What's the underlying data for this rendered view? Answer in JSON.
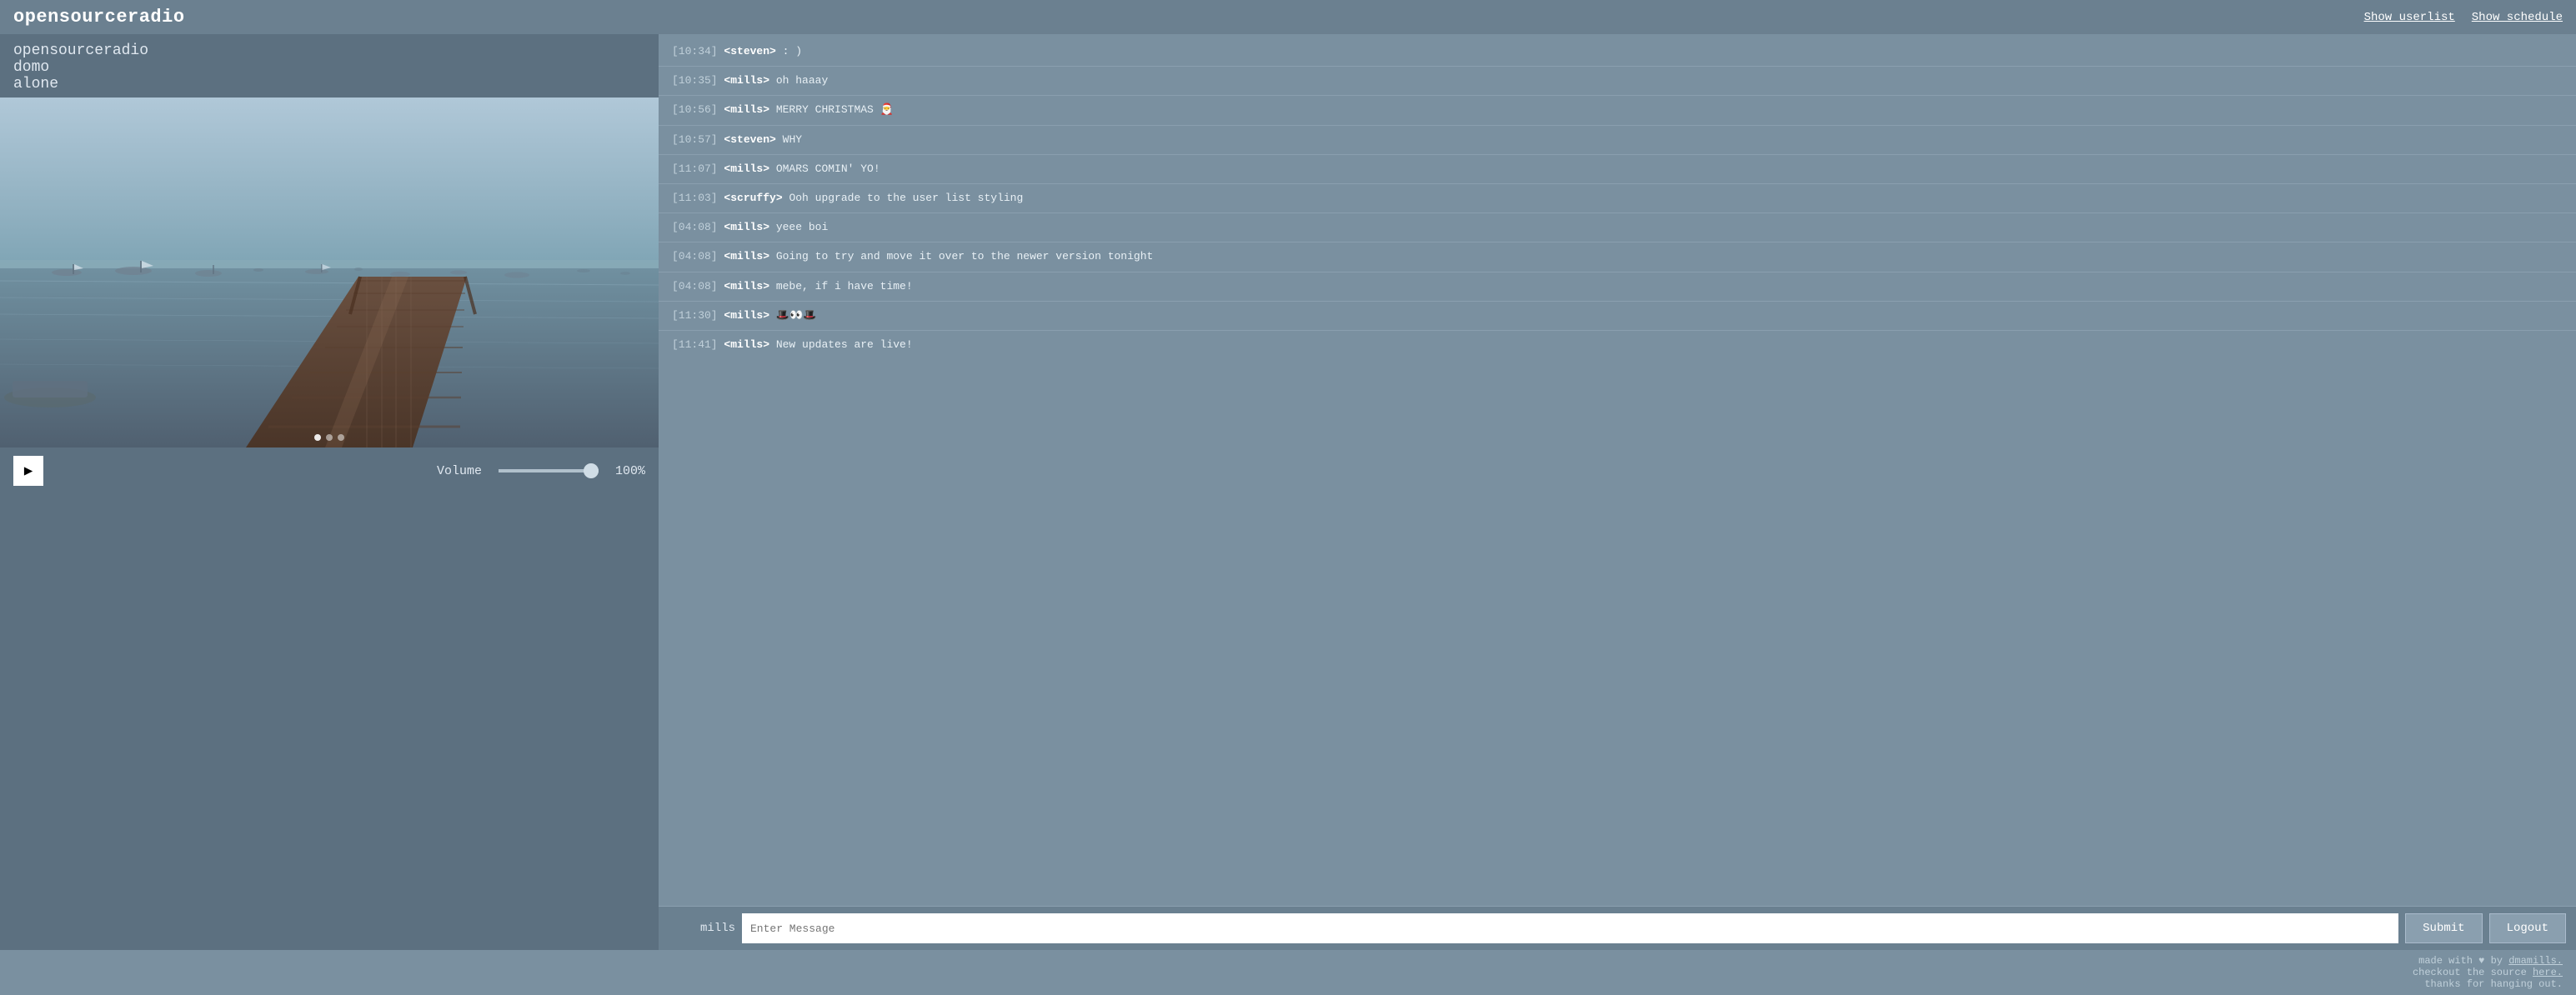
{
  "header": {
    "title": "opensourceradio",
    "links": {
      "userlist": "Show userlist",
      "schedule": "Show schedule"
    }
  },
  "player": {
    "track": {
      "line1": "opensourceradio",
      "line2": "domo",
      "line3": "alone"
    },
    "volume_label": "Volume",
    "volume_percent": "100%",
    "play_icon": "▶"
  },
  "chat": {
    "messages": [
      {
        "time": "[10:34]",
        "user": "<steven>",
        "text": " : )"
      },
      {
        "time": "[10:35]",
        "user": "<mills>",
        "text": " oh haaay"
      },
      {
        "time": "[10:56]",
        "user": "<mills>",
        "text": " MERRY CHRISTMAS 🎅"
      },
      {
        "time": "[10:57]",
        "user": "<steven>",
        "text": " WHY"
      },
      {
        "time": "[11:07]",
        "user": "<mills>",
        "text": " OMARS COMIN' YO!"
      },
      {
        "time": "[11:03]",
        "user": "<scruffy>",
        "text": " Ooh upgrade to the user list styling"
      },
      {
        "time": "[04:08]",
        "user": "<mills>",
        "text": " yeee boi"
      },
      {
        "time": "[04:08]",
        "user": "<mills>",
        "text": " Going to try and move it over to the newer version tonight"
      },
      {
        "time": "[04:08]",
        "user": "<mills>",
        "text": " mebe, if i have time!"
      },
      {
        "time": "[11:30]",
        "user": "<mills>",
        "text": " 🎩👀🎩"
      },
      {
        "time": "[11:41]",
        "user": "<mills>",
        "text": " New updates are live!"
      }
    ],
    "username": "mills",
    "input_placeholder": "Enter Message",
    "submit_label": "Submit",
    "logout_label": "Logout"
  },
  "footer": {
    "text1": "made with ♥ by ",
    "author": "dmamills.",
    "text2": "checkout the source ",
    "source_link": "here.",
    "text3": "thanks for hanging out."
  }
}
